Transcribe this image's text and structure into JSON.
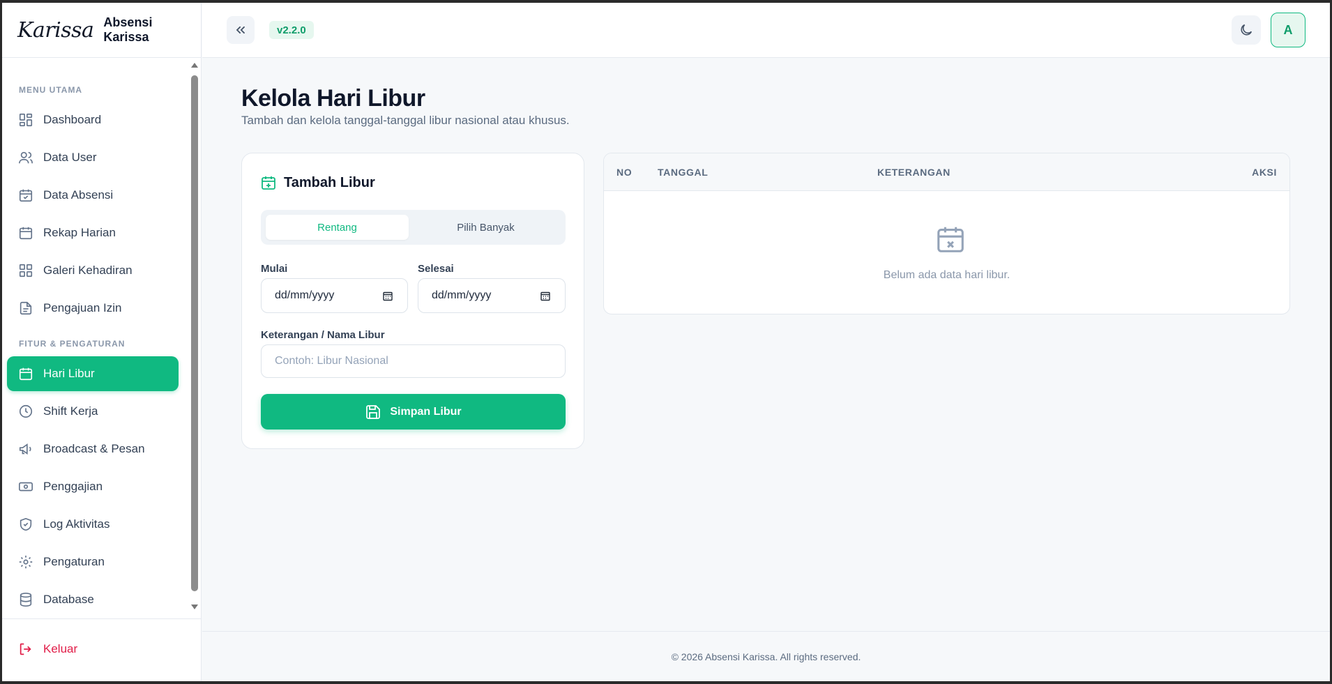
{
  "brand": {
    "logo": "Karissa",
    "name": "Absensi Karissa"
  },
  "header": {
    "version": "v2.2.0",
    "avatar_initial": "A"
  },
  "sidebar": {
    "section_main": "MENU UTAMA",
    "section_settings": "FITUR & PENGATURAN",
    "items": [
      {
        "label": "Dashboard",
        "icon": "grid-icon"
      },
      {
        "label": "Data User",
        "icon": "users-icon"
      },
      {
        "label": "Data Absensi",
        "icon": "calendar-check-icon"
      },
      {
        "label": "Rekap Harian",
        "icon": "calendar-icon"
      },
      {
        "label": "Galeri Kehadiran",
        "icon": "grid-icon"
      },
      {
        "label": "Pengajuan Izin",
        "icon": "document-icon"
      },
      {
        "label": "Hari Libur",
        "icon": "calendar-icon",
        "active": true
      },
      {
        "label": "Shift Kerja",
        "icon": "clock-icon"
      },
      {
        "label": "Broadcast & Pesan",
        "icon": "megaphone-icon"
      },
      {
        "label": "Penggajian",
        "icon": "banknote-icon"
      },
      {
        "label": "Log Aktivitas",
        "icon": "shield-check-icon"
      },
      {
        "label": "Pengaturan",
        "icon": "gear-icon"
      },
      {
        "label": "Database",
        "icon": "database-icon"
      }
    ],
    "logout": "Keluar"
  },
  "page": {
    "title": "Kelola Hari Libur",
    "subtitle": "Tambah dan kelola tanggal-tanggal libur nasional atau khusus."
  },
  "form": {
    "title": "Tambah Libur",
    "tabs": [
      "Rentang",
      "Pilih Banyak"
    ],
    "start_label": "Mulai",
    "start_value": "dd/mm/yyyy",
    "end_label": "Selesai",
    "end_value": "dd/mm/yyyy",
    "desc_label": "Keterangan / Nama Libur",
    "desc_placeholder": "Contoh: Libur Nasional",
    "save_label": "Simpan Libur"
  },
  "table": {
    "columns": [
      "NO",
      "TANGGAL",
      "KETERANGAN",
      "AKSI"
    ],
    "empty_text": "Belum ada data hari libur."
  },
  "footer": {
    "text": "© 2026 Absensi Karissa. All rights reserved."
  },
  "colors": {
    "accent": "#10b981",
    "danger": "#e11d48"
  }
}
